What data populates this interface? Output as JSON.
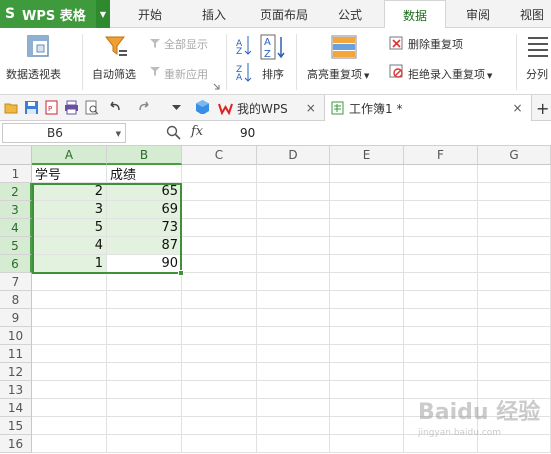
{
  "app": {
    "name": "WPS 表格",
    "logo_letter": "S",
    "brand_color": "#3e9a3c",
    "menu_tabs": [
      "开始",
      "插入",
      "页面布局",
      "公式",
      "数据",
      "审阅",
      "视图"
    ],
    "active_menu_tab": "数据"
  },
  "ribbon": {
    "pivot_table": "数据透视表",
    "auto_filter": "自动筛选",
    "show_all": "全部显示",
    "reapply": "重新应用",
    "sort": "排序",
    "highlight_duplicates": "高亮重复项",
    "remove_duplicates": "删除重复项",
    "reject_duplicates": "拒绝录入重复项",
    "split_columns": "分列"
  },
  "doc_tabs": [
    {
      "label": "我的WPS",
      "close": "×"
    },
    {
      "label": "工作簿1 *",
      "close": "×"
    }
  ],
  "new_tab": "+",
  "formula_bar": {
    "name_box": "B6",
    "fx": "fx",
    "value": "90"
  },
  "sheet": {
    "columns": [
      "A",
      "B",
      "C",
      "D",
      "E",
      "F",
      "G"
    ],
    "rows": [
      "1",
      "2",
      "3",
      "4",
      "5",
      "6",
      "7",
      "8",
      "9",
      "10",
      "11",
      "12",
      "13",
      "14",
      "15",
      "16"
    ],
    "headers": {
      "a": "学号",
      "b": "成绩"
    },
    "data": [
      {
        "a": "2",
        "b": "65"
      },
      {
        "a": "3",
        "b": "69"
      },
      {
        "a": "5",
        "b": "73"
      },
      {
        "a": "4",
        "b": "87"
      },
      {
        "a": "1",
        "b": "90"
      }
    ],
    "selection": "A2:B6",
    "active_cell": "B6"
  }
}
